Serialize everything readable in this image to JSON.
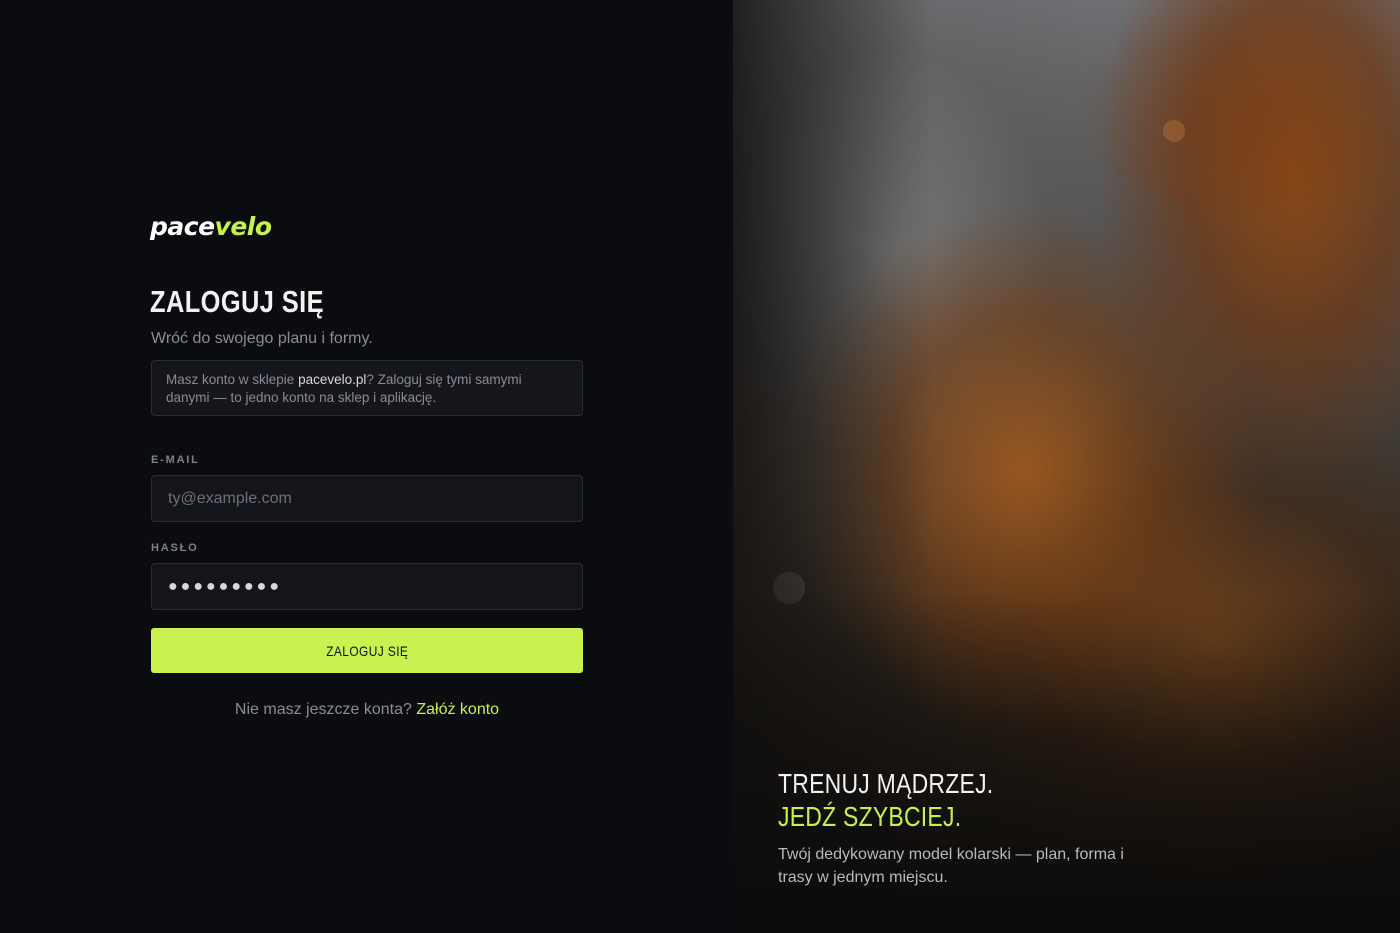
{
  "brand": {
    "logo_part1": "pace",
    "logo_part2": "velo",
    "accent_color": "#c6f24e"
  },
  "login": {
    "title": "ZALOGUJ SIĘ",
    "subtitle": "Wróć do swojego planu i formy.",
    "note_prefix": "Masz konto w sklepie ",
    "note_link": "pacevelo.pl",
    "note_suffix": "? Zaloguj się tymi samymi danymi — to jedno konto na sklep i aplikację.",
    "email_label": "E-MAIL",
    "email_placeholder": "ty@example.com",
    "email_value": "",
    "password_label": "HASŁO",
    "password_value": "●●●●●●●●●",
    "submit_label": "ZALOGUJ SIĘ",
    "signup_prompt": "Nie masz jeszcze konta?",
    "signup_link": "Załóż konto"
  },
  "hero": {
    "line1": "TRENUJ MĄDRZEJ.",
    "line2": "JEDŹ SZYBCIEJ.",
    "description": "Twój dedykowany model kolarski — plan, forma i trasy w jednym miejscu."
  }
}
